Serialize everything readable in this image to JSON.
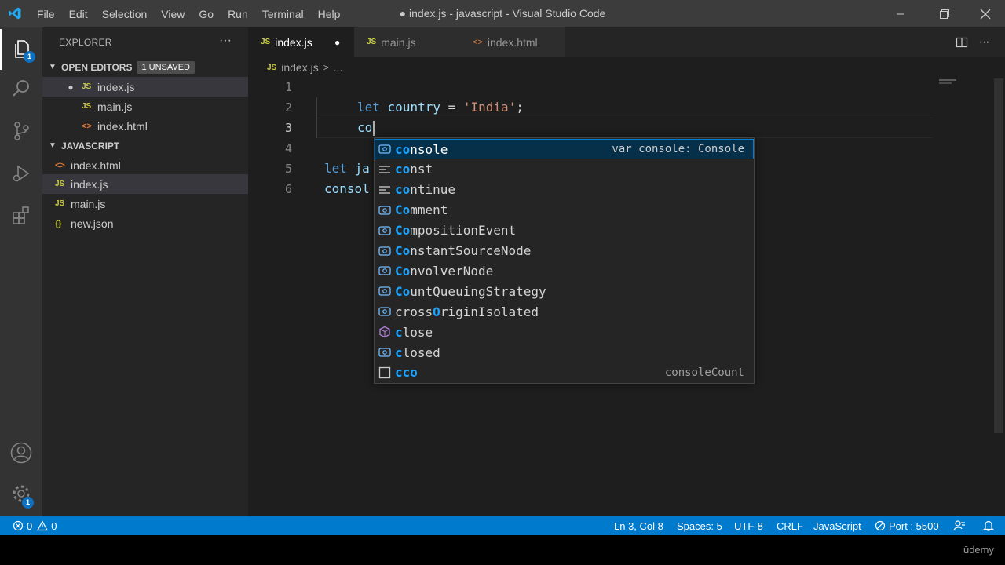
{
  "window": {
    "title": "● index.js - javascript - Visual Studio Code",
    "menu": [
      "File",
      "Edit",
      "Selection",
      "View",
      "Go",
      "Run",
      "Terminal",
      "Help"
    ]
  },
  "activity_bar": {
    "explorer_badge": "1",
    "settings_badge": "1"
  },
  "sidebar": {
    "title": "EXPLORER",
    "more": "···",
    "open_editors": {
      "label": "OPEN EDITORS",
      "badge": "1 UNSAVED",
      "items": [
        {
          "icon": "JS",
          "name": "index.js"
        },
        {
          "icon": "JS",
          "name": "main.js"
        },
        {
          "icon": "<>",
          "name": "index.html"
        }
      ]
    },
    "folder": {
      "label": "JAVASCRIPT",
      "items": [
        {
          "icon": "<>",
          "name": "index.html"
        },
        {
          "icon": "JS",
          "name": "index.js"
        },
        {
          "icon": "JS",
          "name": "main.js"
        },
        {
          "icon": "{}",
          "name": "new.json"
        }
      ]
    }
  },
  "tabs": [
    {
      "icon": "JS",
      "label": "index.js",
      "dirty": "●"
    },
    {
      "icon": "JS",
      "label": "main.js"
    },
    {
      "icon": "<>",
      "label": "index.html"
    }
  ],
  "breadcrumb": {
    "icon": "JS",
    "file": "index.js",
    "sep": ">",
    "more": "..."
  },
  "editor": {
    "line_numbers": [
      "1",
      "2",
      "3",
      "4",
      "5",
      "6"
    ],
    "line2": {
      "kw": "let",
      "name": "country",
      "op": " = ",
      "str": "'India'",
      "end": ";"
    },
    "line3": "co",
    "line5": {
      "kw": "let",
      "name": "ja"
    },
    "line6": "consol"
  },
  "suggestions": {
    "typed": "co",
    "items": [
      {
        "pre": "",
        "match": "co",
        "rest": "nsole",
        "detail": "var console: Console"
      },
      {
        "pre": "",
        "match": "co",
        "rest": "nst",
        "detail": ""
      },
      {
        "pre": "",
        "match": "co",
        "rest": "ntinue",
        "detail": ""
      },
      {
        "pre": "",
        "match": "Co",
        "rest": "mment",
        "detail": ""
      },
      {
        "pre": "",
        "match": "Co",
        "rest": "mpositionEvent",
        "detail": ""
      },
      {
        "pre": "",
        "match": "Co",
        "rest": "nstantSourceNode",
        "detail": ""
      },
      {
        "pre": "",
        "match": "Co",
        "rest": "nvolverNode",
        "detail": ""
      },
      {
        "pre": "",
        "match": "Co",
        "rest": "untQueuingStrategy",
        "detail": ""
      },
      {
        "pre": "cross",
        "match": "O",
        "rest": "riginIsolated",
        "detail": ""
      },
      {
        "pre": "",
        "match": "c",
        "rest": "lose",
        "detail": ""
      },
      {
        "pre": "",
        "match": "c",
        "rest": "losed",
        "detail": ""
      },
      {
        "pre": "",
        "match": "cco",
        "rest": "",
        "detail": "consoleCount"
      }
    ]
  },
  "statusbar": {
    "errors": "0",
    "warnings": "0",
    "position": "Ln 3, Col 8",
    "spaces": "Spaces: 5",
    "encoding": "UTF-8",
    "eol": "CRLF",
    "language": "JavaScript",
    "port": "Port : 5500"
  },
  "watermark": "ūdemy",
  "colors": {
    "statusbar": "#007acc",
    "keyword": "#569cd6",
    "string": "#ce9178",
    "variable": "#9cdcfe",
    "match_highlight": "#18a3ff",
    "js_icon": "#cbcb41",
    "html_icon": "#e37933"
  }
}
